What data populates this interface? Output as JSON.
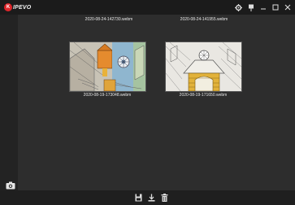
{
  "app": {
    "logo_badge": "K",
    "logo_text": "IPEVO"
  },
  "window": {
    "controls": [
      "settings-icon",
      "pin-icon",
      "minimize-icon",
      "maximize-icon",
      "close-icon"
    ]
  },
  "files": {
    "top_row": [
      "2020-08-24-142730.webm",
      "2020-08-24-141955.webm"
    ],
    "items": [
      {
        "name": "2020-08-19-173048.webm",
        "thumb": "colored-castle-drawing"
      },
      {
        "name": "2020-08-19-171650.webm",
        "thumb": "uncolored-castle-drawing"
      }
    ]
  },
  "bottom": {
    "icons": [
      "save-icon",
      "download-icon",
      "trash-icon"
    ]
  },
  "left": {
    "camera": "camera-icon"
  },
  "colors": {
    "accent": "#e0262b",
    "titlebar": "#1b1b1b",
    "background": "#2d2d2d"
  }
}
